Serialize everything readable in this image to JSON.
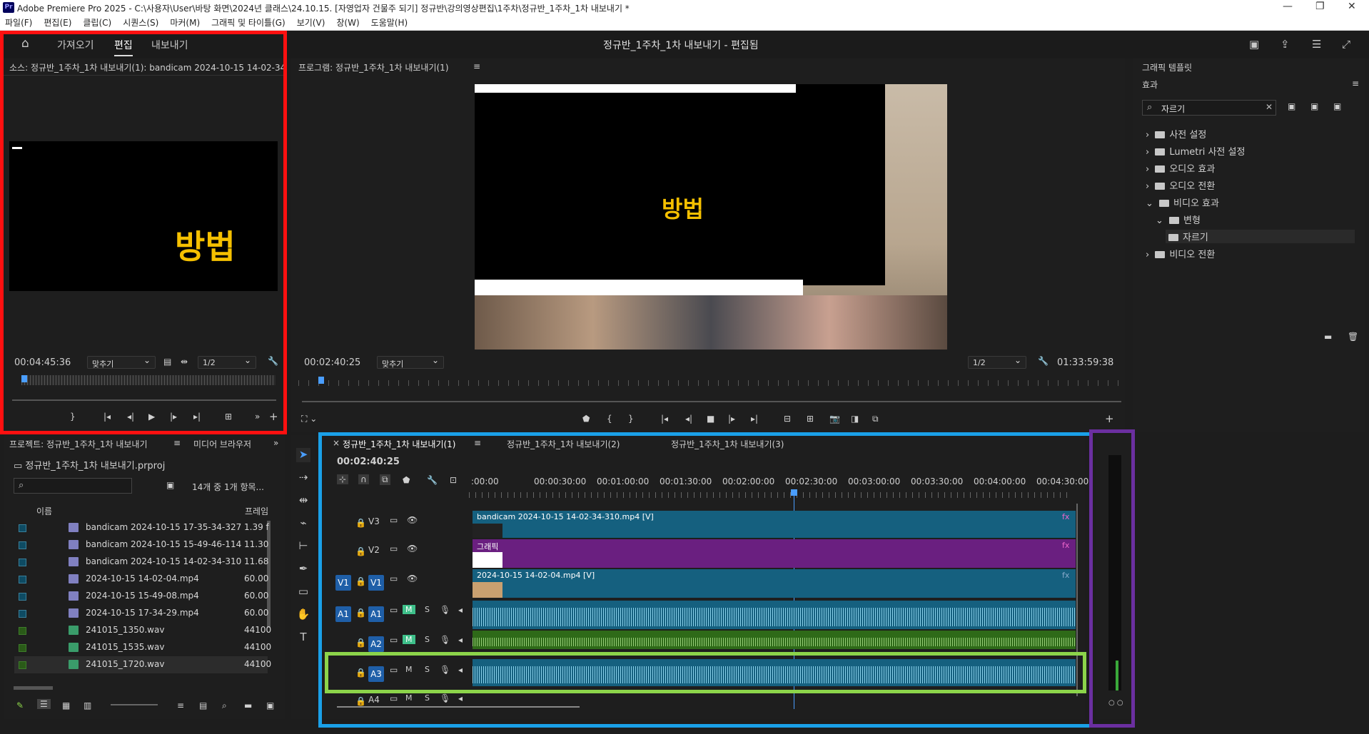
{
  "titlebar": {
    "app_icon": "Pr",
    "title": "Adobe Premiere Pro 2025 - C:\\사용자\\User\\바탕 화면\\2024년 클래스\\24.10.15. [자영업자 건물주 되기] 정규반\\강의영상편집\\1주차\\정규반_1주차_1차 내보내기 *"
  },
  "menu": [
    "파일(F)",
    "편집(E)",
    "클립(C)",
    "시퀀스(S)",
    "마커(M)",
    "그래픽 및 타이틀(G)",
    "보기(V)",
    "창(W)",
    "도움말(H)"
  ],
  "workspace": {
    "home": "home-icon",
    "import": "가져오기",
    "edit": "편집",
    "export": "내보내기",
    "project_title": "정규반_1주차_1차 내보내기 - 편집됨"
  },
  "source": {
    "tab": "소스: 정규반_1주차_1차 내보내기(1): bandicam 2024-10-15 14-02-34-",
    "overlay": "방법",
    "timecode": "00:04:45:36",
    "fit": "맞추기",
    "res": "1/2"
  },
  "program": {
    "tab": "프로그램: 정규반_1주차_1차 내보내기(1)",
    "overlay": "방법",
    "timecode": "00:02:40:25",
    "fit": "맞추기",
    "res": "1/2",
    "duration": "01:33:59:38"
  },
  "effects": {
    "tab_templates": "그래픽 템플릿",
    "tab_effects": "효과",
    "search": "자르기",
    "tree": [
      {
        "label": "사전 설정",
        "indent": 0,
        "open": false
      },
      {
        "label": "Lumetri 사전 설정",
        "indent": 0,
        "open": false
      },
      {
        "label": "오디오 효과",
        "indent": 0,
        "open": false
      },
      {
        "label": "오디오 전환",
        "indent": 0,
        "open": false
      },
      {
        "label": "비디오 효과",
        "indent": 0,
        "open": true
      },
      {
        "label": "변형",
        "indent": 1,
        "open": true
      },
      {
        "label": "자르기",
        "indent": 2,
        "open": false
      },
      {
        "label": "비디오 전환",
        "indent": 0,
        "open": false
      }
    ]
  },
  "project": {
    "tab": "프로젝트: 정규반_1주차_1차 내보내기",
    "tab2": "미디어 브라우저",
    "file": "정규반_1주차_1차 내보내기.prproj",
    "count": "14개 중 1개 항목...",
    "col_name": "이름",
    "col_rate": "프레임",
    "items": [
      {
        "name": "bandicam 2024-10-15 17-35-34-327",
        "rate": "1.39 f",
        "type": "v"
      },
      {
        "name": "bandicam 2024-10-15 15-49-46-114",
        "rate": "11.30",
        "type": "v"
      },
      {
        "name": "bandicam 2024-10-15 14-02-34-310",
        "rate": "11.68",
        "type": "v"
      },
      {
        "name": "2024-10-15 14-02-04.mp4",
        "rate": "60.00",
        "type": "v"
      },
      {
        "name": "2024-10-15 15-49-08.mp4",
        "rate": "60.00",
        "type": "v"
      },
      {
        "name": "2024-10-15 17-34-29.mp4",
        "rate": "60.00",
        "type": "v"
      },
      {
        "name": "241015_1350.wav",
        "rate": "44100",
        "type": "a"
      },
      {
        "name": "241015_1535.wav",
        "rate": "44100",
        "type": "a"
      },
      {
        "name": "241015_1720.wav",
        "rate": "44100",
        "type": "a"
      }
    ]
  },
  "timeline": {
    "tabs": [
      "정규반_1주차_1차 내보내기(1)",
      "정규반_1주차_1차 내보내기(2)",
      "정규반_1주차_1차 내보내기(3)"
    ],
    "timecode": "00:02:40:25",
    "ruler": [
      ":00:00",
      "00:00:30:00",
      "00:01:00:00",
      "00:01:30:00",
      "00:02:00:00",
      "00:02:30:00",
      "00:03:00:00",
      "00:03:30:00",
      "00:04:00:00",
      "00:04:30:00"
    ],
    "tracks": [
      "V3",
      "V2",
      "V1",
      "A1",
      "A2",
      "A3",
      "A4"
    ],
    "clips": {
      "v3": "bandicam 2024-10-15 14-02-34-310.mp4 [V]",
      "v2": "그래픽",
      "v1": "2024-10-15 14-02-04.mp4 [V]"
    },
    "m": "M",
    "s": "S",
    "fx": "fx"
  }
}
